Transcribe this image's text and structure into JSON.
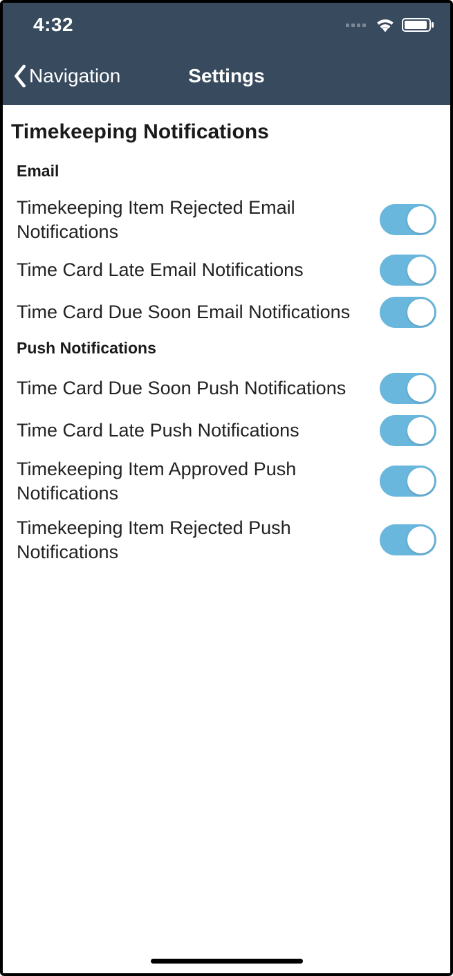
{
  "statusBar": {
    "time": "4:32"
  },
  "navBar": {
    "backLabel": "Navigation",
    "title": "Settings"
  },
  "page": {
    "title": "Timekeeping Notifications",
    "sections": [
      {
        "header": "Email",
        "items": [
          {
            "label": "Timekeeping Item Rejected Email Notifications",
            "on": true
          },
          {
            "label": "Time Card Late Email Notifications",
            "on": true
          },
          {
            "label": "Time Card Due Soon Email Notifications",
            "on": true
          }
        ]
      },
      {
        "header": "Push Notifications",
        "items": [
          {
            "label": "Time Card Due Soon Push Notifications",
            "on": true
          },
          {
            "label": "Time Card Late Push Notifications",
            "on": true
          },
          {
            "label": "Timekeeping Item Approved Push Notifications",
            "on": true
          },
          {
            "label": "Timekeeping Item Rejected Push Notifications",
            "on": true
          }
        ]
      }
    ]
  }
}
